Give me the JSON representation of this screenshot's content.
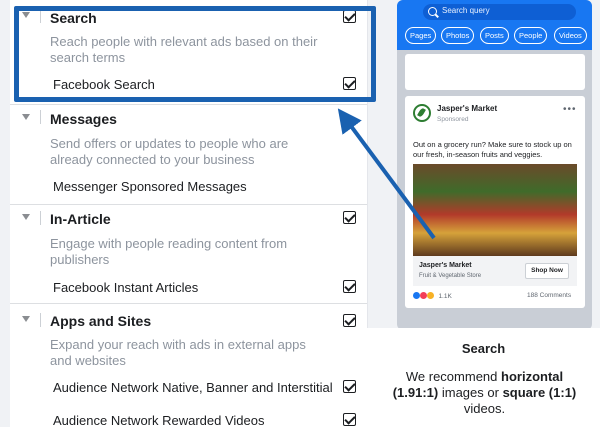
{
  "placements": {
    "search": {
      "title": "Search",
      "description": "Reach people with relevant ads based on their search terms",
      "option": "Facebook Search"
    },
    "messages": {
      "title": "Messages",
      "description": "Send offers or updates to people who are already connected to your business",
      "option": "Messenger Sponsored Messages"
    },
    "in_article": {
      "title": "In-Article",
      "description": "Engage with people reading content from publishers",
      "option": "Facebook Instant Articles"
    },
    "apps_sites": {
      "title": "Apps and Sites",
      "description": "Expand your reach with ads in external apps and websites",
      "option1": "Audience Network Native, Banner and Interstitial",
      "option2": "Audience Network Rewarded Videos"
    }
  },
  "preview": {
    "search_placeholder": "Search query",
    "chips": [
      "Pages",
      "Photos",
      "Posts",
      "People",
      "Videos"
    ],
    "ad": {
      "name": "Jasper's Market",
      "sponsored": "Sponsored",
      "body": "Out on a grocery run? Make sure to stock up on our fresh, in-season fruits and veggies.",
      "footer_title": "Jasper's Market",
      "footer_subtitle": "Fruit & Vegetable Store",
      "cta": "Shop Now",
      "reactions": "1.1K",
      "comments": "188 Comments"
    }
  },
  "recommendation": {
    "title": "Search",
    "text_1": "We recommend ",
    "bold_1": "horizontal (1.91:1)",
    "text_2": " images or ",
    "bold_2": "square (1:1)",
    "text_3": " videos."
  },
  "colors": {
    "highlight": "#1a61b0",
    "facebook_blue": "#1877f2"
  }
}
